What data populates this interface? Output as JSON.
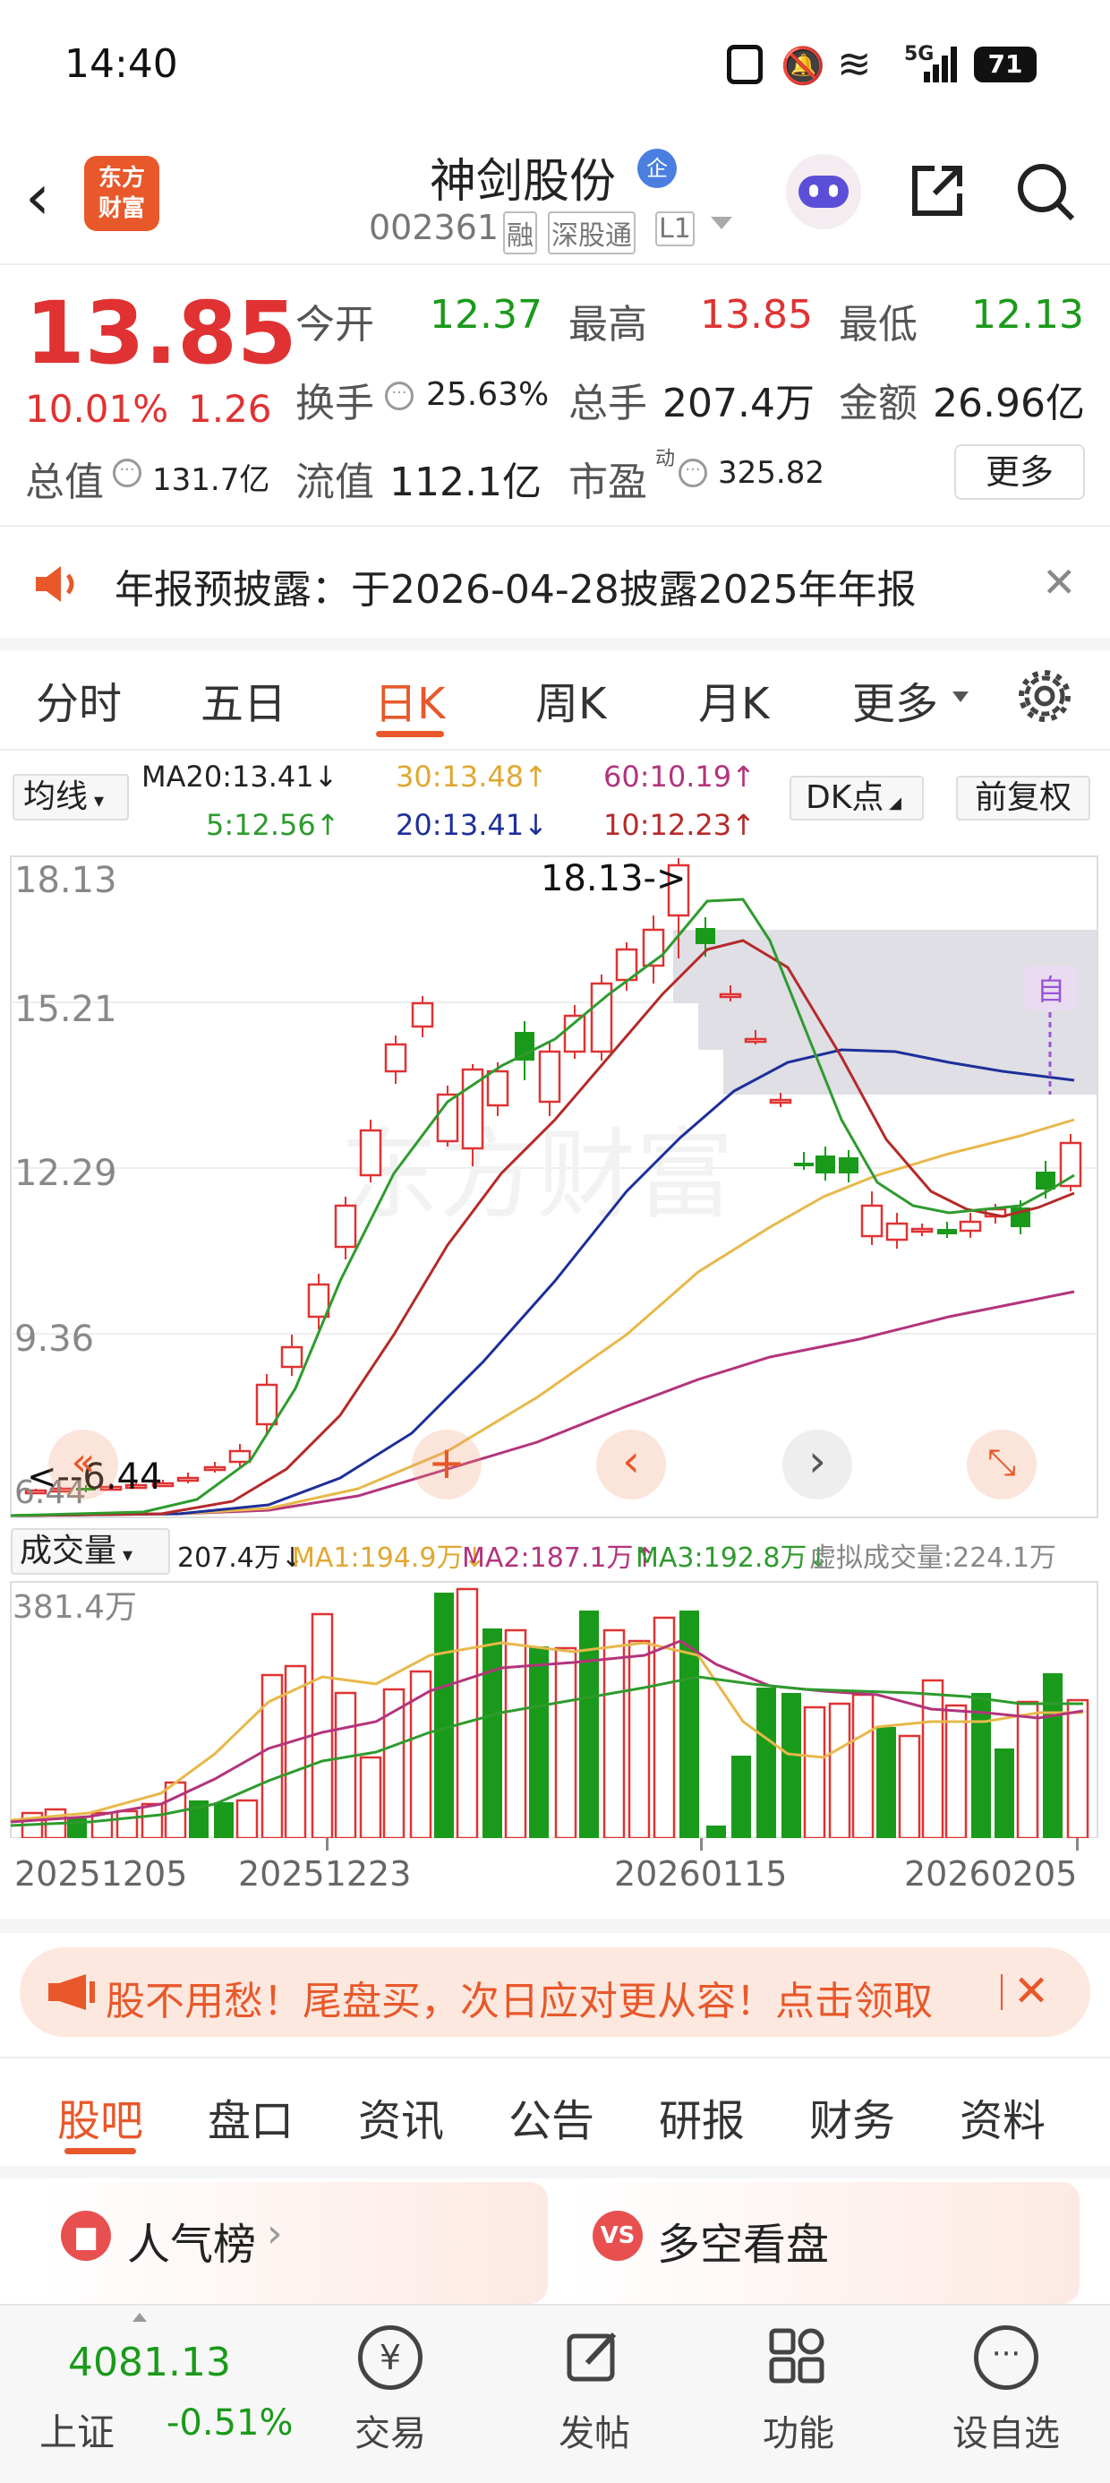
{
  "status_bar": {
    "time": "14:40",
    "network": "5G",
    "battery": "71"
  },
  "header": {
    "title": "神剑股份",
    "badge": "企",
    "code": "002361",
    "tags": [
      "融",
      "深股通",
      "L1"
    ]
  },
  "quote": {
    "price": "13.85",
    "change_pct": "10.01%",
    "change": "1.26",
    "fields": [
      {
        "label": "今开",
        "value": "12.37"
      },
      {
        "label": "最高",
        "value": "13.85"
      },
      {
        "label": "最低",
        "value": "12.13"
      },
      {
        "label": "换手",
        "value": "25.63%"
      },
      {
        "label": "总手",
        "value": "207.4万"
      },
      {
        "label": "金额",
        "value": "26.96亿"
      },
      {
        "label": "总值",
        "value": "131.7亿"
      },
      {
        "label": "流值",
        "value": "112.1亿"
      },
      {
        "label": "市盈",
        "value": "325.82",
        "sup": "动"
      }
    ],
    "more": "更多"
  },
  "notice": {
    "text": "年报预披露：于2026-04-28披露2025年年报"
  },
  "chart_tabs": [
    "分时",
    "五日",
    "日K",
    "周K",
    "月K",
    "更多"
  ],
  "active_chart_tab": "日K",
  "ma_bar": {
    "selector": "均线",
    "ma20": "MA20:13.41↓",
    "ma5": "5:12.56↑",
    "ma30": "30:13.48↑",
    "ma20b": "20:13.41↓",
    "ma60": "60:10.19↑",
    "ma10": "10:12.23↑",
    "dk": "DK点",
    "adjust": "前复权"
  },
  "kline": {
    "y_ticks": [
      "18.13",
      "15.21",
      "12.29",
      "9.36",
      "6.44"
    ],
    "high_label": "18.13->",
    "low_label": "<--6.44",
    "zi": "自"
  },
  "volume_bar": {
    "selector": "成交量",
    "vol": "207.4万↓",
    "ma1": "MA1:194.9万↓",
    "ma2": "MA2:187.1万↑",
    "ma3": "MA3:192.8万↓",
    "virtual": "虚拟成交量:224.1万",
    "max_label": "381.4万"
  },
  "x_dates": [
    "20251205",
    "20251223",
    "20260115",
    "20260205"
  ],
  "promo": {
    "text": "股不用愁！尾盘买，次日应对更从容！点击领取"
  },
  "bottom_tabs": [
    "股吧",
    "盘口",
    "资讯",
    "公告",
    "研报",
    "财务",
    "资料"
  ],
  "active_bottom_tab": "股吧",
  "cards": [
    {
      "title": "人气榜"
    },
    {
      "title": "多空看盘"
    }
  ],
  "nav": {
    "index_value": "4081.13",
    "index_name": "上证",
    "index_change": "-0.51%",
    "items": [
      "交易",
      "发帖",
      "功能",
      "设自选"
    ]
  },
  "colors": {
    "up": "#e03232",
    "down": "#1a9a1a",
    "accent": "#e8582a",
    "ma5": "#2e9b2e",
    "ma10": "#b52a2a",
    "ma20": "#1d2f9a",
    "ma30": "#e8b84a",
    "ma60": "#b3347c"
  }
}
